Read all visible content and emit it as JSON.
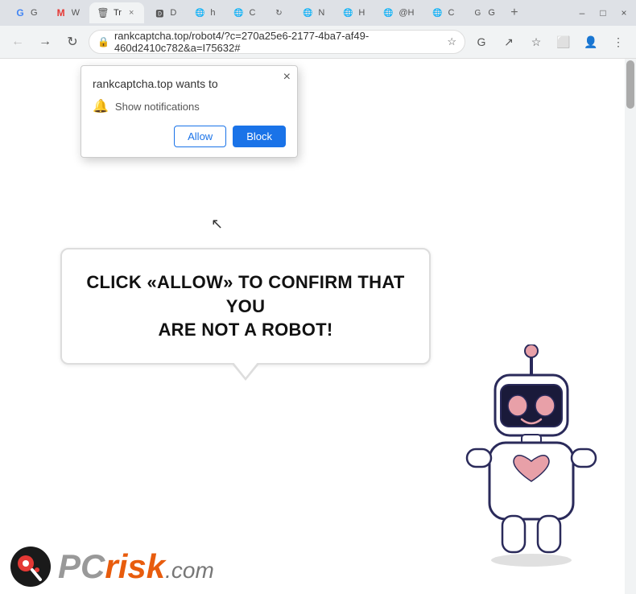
{
  "browser": {
    "tabs": [
      {
        "id": "tab-g",
        "label": "G",
        "favicon": "G",
        "active": false
      },
      {
        "id": "tab-mw",
        "label": "MW",
        "favicon": "MW",
        "active": false
      },
      {
        "id": "tab-active",
        "label": "Tr",
        "favicon": "🗑",
        "active": true
      },
      {
        "id": "tab-d",
        "label": "D",
        "favicon": "D",
        "active": false
      },
      {
        "id": "tab-h",
        "label": "h",
        "favicon": "h",
        "active": false
      },
      {
        "id": "tab-c",
        "label": "C",
        "favicon": "C",
        "active": false
      },
      {
        "id": "tab-arrow",
        "label": "↻",
        "favicon": "↻",
        "active": false
      },
      {
        "id": "tab-n",
        "label": "N",
        "favicon": "N",
        "active": false
      },
      {
        "id": "tab-h2",
        "label": "H",
        "favicon": "H",
        "active": false
      },
      {
        "id": "tab-h3",
        "label": "@H",
        "favicon": "@H",
        "active": false
      },
      {
        "id": "tab-c2",
        "label": "C",
        "favicon": "C",
        "active": false
      },
      {
        "id": "tab-g2",
        "label": "G",
        "favicon": "G",
        "active": false
      }
    ],
    "url": "rankcaptcha.top/robot4/?c=270a25e6-2177-4ba7-af49-460d2410c782&a=I75632#",
    "nav": {
      "back_disabled": false,
      "forward_disabled": false
    }
  },
  "notification_popup": {
    "title": "rankcaptcha.top wants to",
    "notification_text": "Show notifications",
    "close_label": "×",
    "allow_label": "Allow",
    "block_label": "Block"
  },
  "main": {
    "message_line1": "CLICK «ALLOW» TO CONFIRM THAT YOU",
    "message_line2": "ARE NOT A ROBOT!"
  },
  "watermark": {
    "pc_text": "PC",
    "risk_text": "risk",
    "com_text": ".com"
  },
  "colors": {
    "allow_btn_text": "#1a73e8",
    "block_btn_bg": "#1a73e8",
    "message_text": "#111111",
    "risk_color": "#e85c0d"
  }
}
